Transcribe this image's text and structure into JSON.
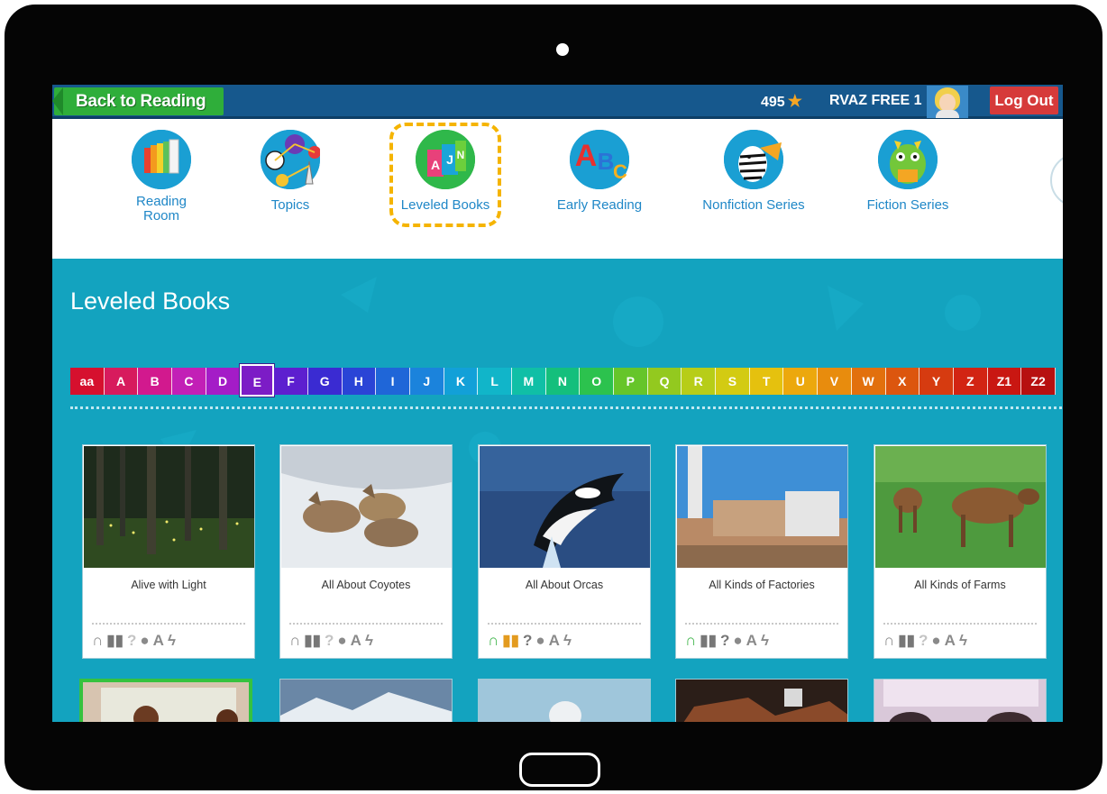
{
  "topbar": {
    "back_label": "Back to Reading",
    "stars": "495",
    "username": "RVAZ FREE 1",
    "logout_label": "Log Out"
  },
  "nav": {
    "items": [
      {
        "label": "Reading Room",
        "icon": "reading-room-icon"
      },
      {
        "label": "Topics",
        "icon": "topics-icon"
      },
      {
        "label": "Leveled Books",
        "icon": "leveled-books-icon",
        "highlighted": true
      },
      {
        "label": "Early Reading",
        "icon": "early-reading-icon"
      },
      {
        "label": "Nonfiction Series",
        "icon": "nonfiction-series-icon"
      },
      {
        "label": "Fiction Series",
        "icon": "fiction-series-icon"
      }
    ]
  },
  "main": {
    "title": "Leveled Books",
    "selected_level": "E",
    "levels": [
      {
        "label": "aa",
        "color": "#d6102e"
      },
      {
        "label": "A",
        "color": "#d71b5d"
      },
      {
        "label": "B",
        "color": "#d2198e"
      },
      {
        "label": "C",
        "color": "#c21fb6"
      },
      {
        "label": "D",
        "color": "#a41cc7"
      },
      {
        "label": "E",
        "color": "#7c1cc6"
      },
      {
        "label": "F",
        "color": "#5d1fcf"
      },
      {
        "label": "G",
        "color": "#3a2bd2"
      },
      {
        "label": "H",
        "color": "#2a44d6"
      },
      {
        "label": "I",
        "color": "#1f66d8"
      },
      {
        "label": "J",
        "color": "#1b83dc"
      },
      {
        "label": "K",
        "color": "#12a0d8"
      },
      {
        "label": "L",
        "color": "#11b5c9"
      },
      {
        "label": "M",
        "color": "#10bfa6"
      },
      {
        "label": "N",
        "color": "#14bf7c"
      },
      {
        "label": "O",
        "color": "#2cc24e"
      },
      {
        "label": "P",
        "color": "#66c52a"
      },
      {
        "label": "Q",
        "color": "#93c91f"
      },
      {
        "label": "R",
        "color": "#b7cd18"
      },
      {
        "label": "S",
        "color": "#d3cb12"
      },
      {
        "label": "T",
        "color": "#e5c10e"
      },
      {
        "label": "U",
        "color": "#eca80d"
      },
      {
        "label": "V",
        "color": "#e88c0d"
      },
      {
        "label": "W",
        "color": "#e2700d"
      },
      {
        "label": "X",
        "color": "#dc560e"
      },
      {
        "label": "Y",
        "color": "#d63b10"
      },
      {
        "label": "Z",
        "color": "#d22413"
      },
      {
        "label": "Z1",
        "color": "#c91712"
      },
      {
        "label": "Z2",
        "color": "#b71010"
      }
    ],
    "books": [
      {
        "title": "Alive with Light",
        "image": "forest-fireflies-photo",
        "icons": [
          "headphones-icon",
          "book-icon",
          "question-icon",
          "apple-icon",
          "font-a-icon",
          "lightning-icon"
        ]
      },
      {
        "title": "All About Coyotes",
        "image": "coyotes-in-snow-photo",
        "icons": [
          "headphones-icon",
          "book-icon",
          "question-icon",
          "apple-icon",
          "font-a-icon",
          "lightning-icon"
        ]
      },
      {
        "title": "All About Orcas",
        "image": "orca-jumping-photo",
        "icons": [
          "headphones-icon",
          "book-icon",
          "question-icon",
          "apple-icon",
          "font-a-icon",
          "lightning-icon"
        ]
      },
      {
        "title": "All Kinds of Factories",
        "image": "factory-photo",
        "icons": [
          "headphones-icon",
          "book-icon",
          "question-icon",
          "apple-icon",
          "font-a-icon",
          "lightning-icon"
        ]
      },
      {
        "title": "All Kinds of Farms",
        "image": "cows-in-field-photo",
        "icons": [
          "headphones-icon",
          "book-icon",
          "question-icon",
          "apple-icon",
          "font-a-icon",
          "lightning-icon"
        ]
      }
    ],
    "icon_glyphs": {
      "headphones": "∩",
      "book": "▮",
      "question": "?",
      "apple": "●",
      "font": "A",
      "lightning": "ϟ"
    }
  }
}
